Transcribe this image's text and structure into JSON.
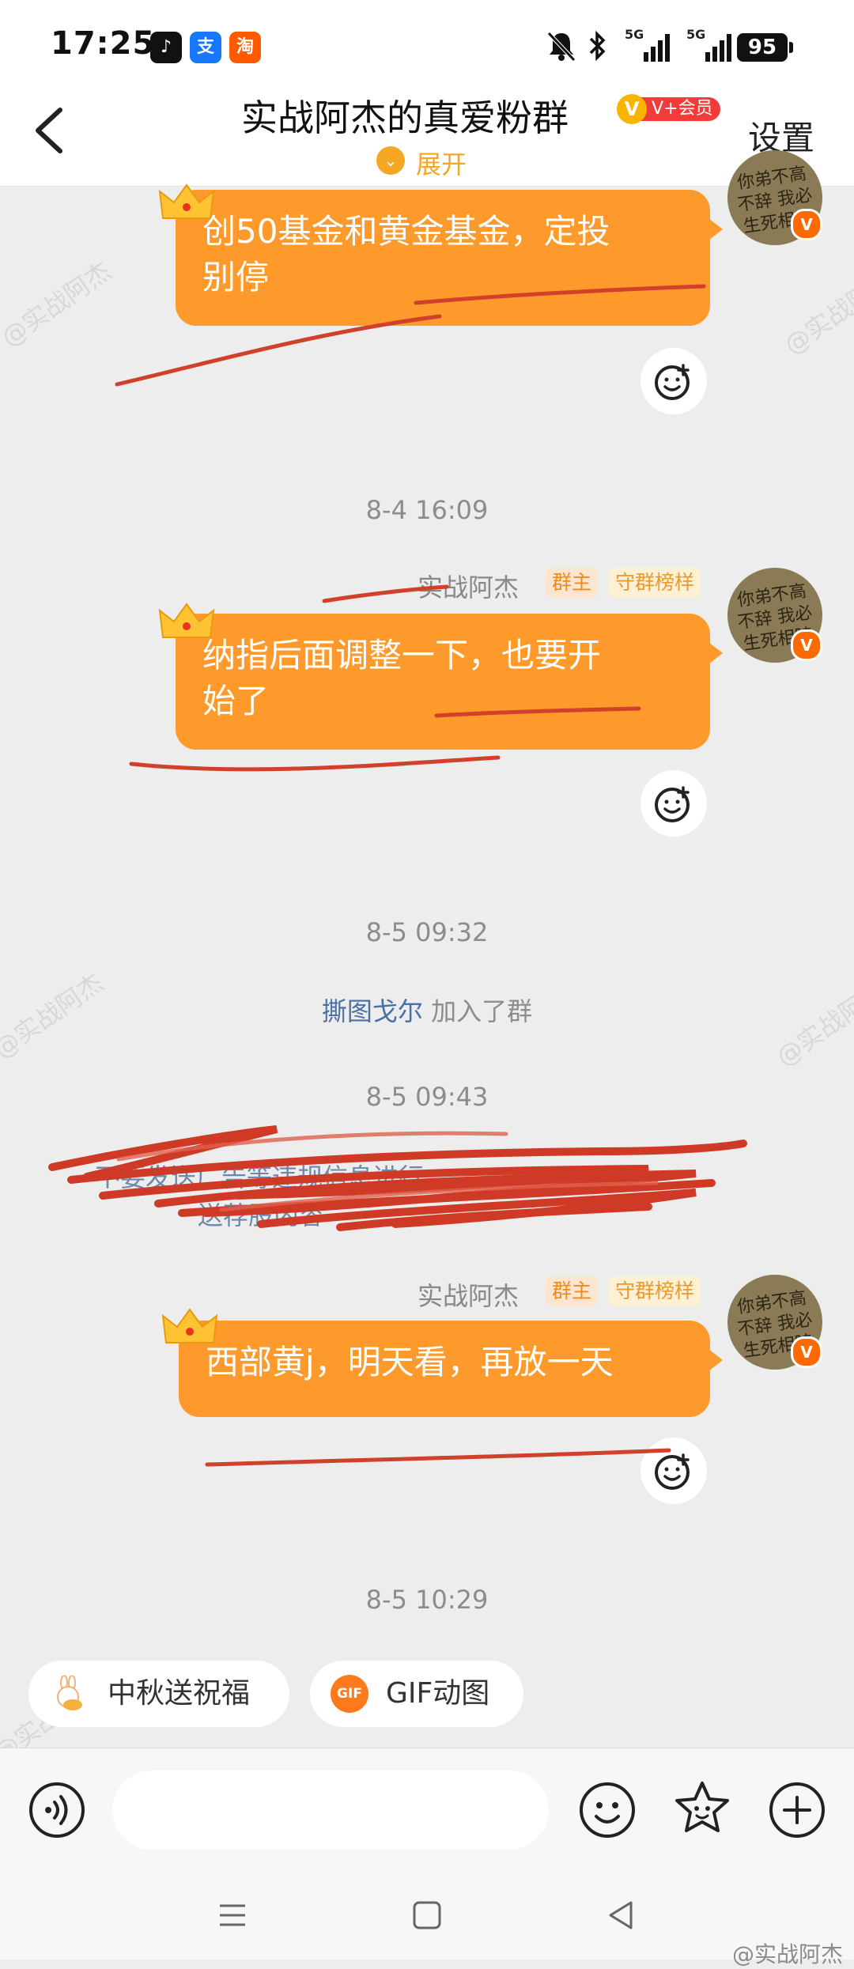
{
  "status_bar": {
    "time": "17:25",
    "app_icons": [
      {
        "name": "tiktok-icon",
        "glyph": "♪"
      },
      {
        "name": "alipay-icon",
        "glyph": "支"
      },
      {
        "name": "taobao-icon",
        "glyph": "淘"
      }
    ],
    "signal_labels": [
      "5G",
      "5G"
    ],
    "battery": "95"
  },
  "header": {
    "title": "实战阿杰的真爱粉群",
    "vip_tag": "V+会员",
    "expand_label": "展开",
    "settings_label": "设置"
  },
  "watermark": "@实战阿杰",
  "messages": [
    {
      "text_line1": "创50基金和黄金基金，定投",
      "text_line2": "别停"
    },
    {
      "timestamp": "8-4 16:09",
      "sender": "实战阿杰",
      "badges": [
        "群主",
        "守群榜样"
      ],
      "text_line1": "纳指后面调整一下，也要开",
      "text_line2": "始了"
    },
    {
      "timestamp": "8-5 09:32",
      "system_user": "撕图戈尔",
      "system_text": " 加入了群"
    },
    {
      "timestamp": "8-5 09:43",
      "obscured_line1": "不要发送广告等违规信息进行",
      "obscured_line2": "送荐股内容"
    },
    {
      "sender": "实战阿杰",
      "badges": [
        "群主",
        "守群榜样"
      ],
      "text_line1": "西部黄j，明天看，再放一天"
    },
    {
      "timestamp": "8-5 10:29"
    }
  ],
  "quick_chips": [
    {
      "label": "中秋送祝福",
      "icon": "rabbit-icon"
    },
    {
      "label": "GIF动图",
      "icon": "gif-icon",
      "icon_text": "GIF"
    }
  ],
  "input_bar": {
    "placeholder": ""
  },
  "footer_watermark": "@实战阿杰",
  "colors": {
    "bubble": "#fd9a2b",
    "accent": "#f5a623",
    "annotation_red": "#d0402b",
    "link": "#4a6fa5"
  }
}
